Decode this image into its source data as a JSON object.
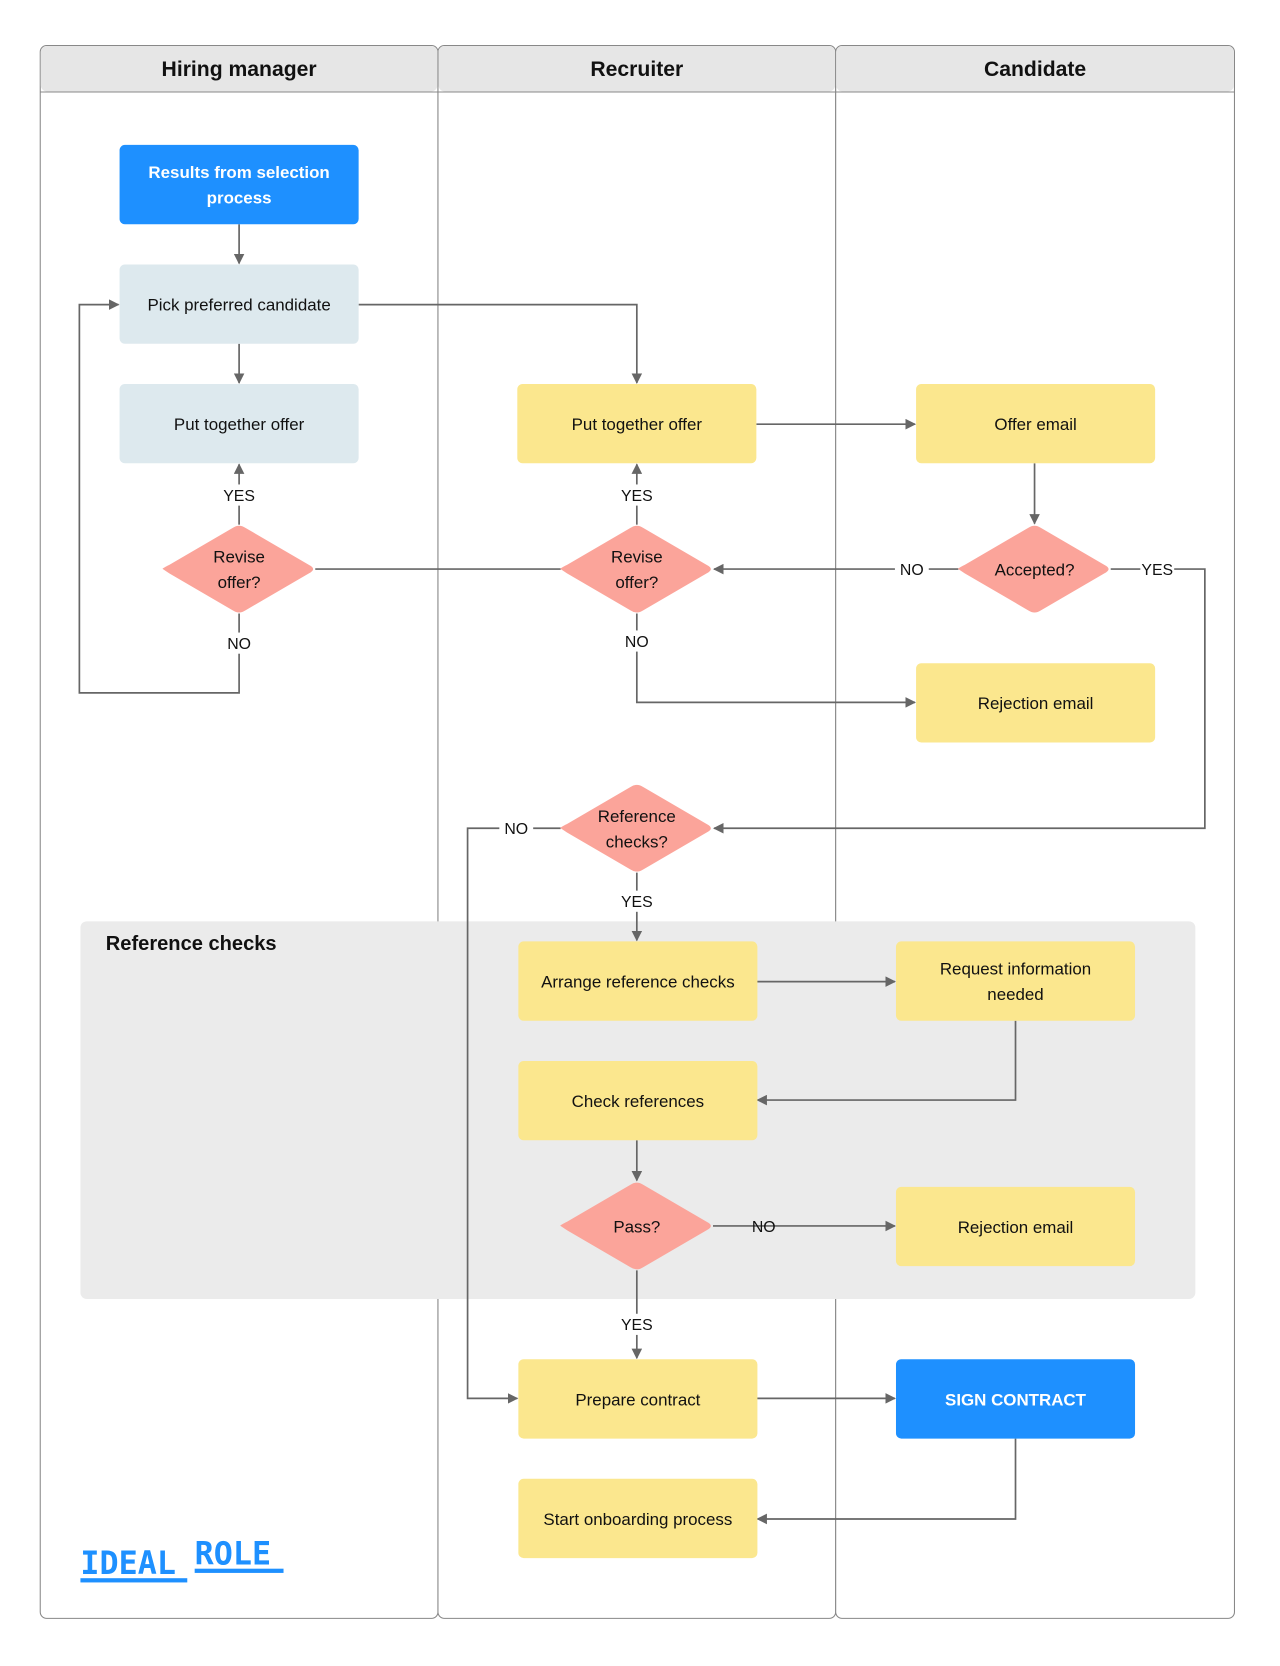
{
  "lanes": [
    {
      "title": "Hiring manager"
    },
    {
      "title": "Recruiter"
    },
    {
      "title": "Candidate"
    }
  ],
  "group": {
    "title": "Reference checks"
  },
  "nodes": {
    "results": {
      "lines": [
        "Results from selection",
        "process"
      ],
      "kind": "start"
    },
    "pick": {
      "lines": [
        "Pick preferred candidate"
      ],
      "kind": "hm"
    },
    "hm_offer": {
      "lines": [
        "Put together offer"
      ],
      "kind": "hm"
    },
    "hm_revise": {
      "lines": [
        "Revise",
        "offer?"
      ],
      "kind": "decision"
    },
    "rec_offer": {
      "lines": [
        "Put together offer"
      ],
      "kind": "task"
    },
    "rec_revise": {
      "lines": [
        "Revise",
        "offer?"
      ],
      "kind": "decision"
    },
    "offer_email": {
      "lines": [
        "Offer email"
      ],
      "kind": "task"
    },
    "accepted": {
      "lines": [
        "Accepted?"
      ],
      "kind": "decision"
    },
    "rejection1": {
      "lines": [
        "Rejection email"
      ],
      "kind": "task"
    },
    "ref_checks": {
      "lines": [
        "Reference",
        "checks?"
      ],
      "kind": "decision"
    },
    "arrange": {
      "lines": [
        "Arrange reference checks"
      ],
      "kind": "task"
    },
    "request": {
      "lines": [
        "Request information",
        "needed"
      ],
      "kind": "task"
    },
    "check": {
      "lines": [
        "Check references"
      ],
      "kind": "task"
    },
    "pass": {
      "lines": [
        "Pass?"
      ],
      "kind": "decision"
    },
    "rejection2": {
      "lines": [
        "Rejection email"
      ],
      "kind": "task"
    },
    "prepare": {
      "lines": [
        "Prepare contract"
      ],
      "kind": "task"
    },
    "sign": {
      "lines": [
        "SIGN CONTRACT"
      ],
      "kind": "start"
    },
    "onboarding": {
      "lines": [
        "Start onboarding process"
      ],
      "kind": "task"
    }
  },
  "edge_labels": {
    "yes": "YES",
    "no": "NO"
  },
  "logo": {
    "part1": "IDEAL",
    "part2": "ROLE"
  },
  "colors": {
    "start": "#1e90ff",
    "hm": "#dde9ee",
    "task": "#fbe78e",
    "decision": "#fba49a",
    "group": "#ebebeb",
    "lane_header": "#e6e6e6",
    "edge": "#666666"
  }
}
